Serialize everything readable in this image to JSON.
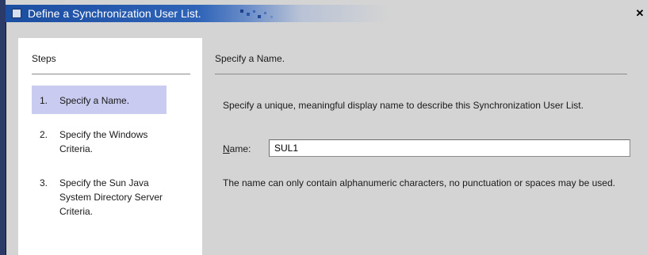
{
  "window": {
    "title": "Define a Synchronization User List.",
    "close_glyph": "✕"
  },
  "steps": {
    "heading": "Steps",
    "items": [
      {
        "number": "1.",
        "label": "Specify a Name.",
        "active": true
      },
      {
        "number": "2.",
        "label": "Specify the Windows Criteria.",
        "active": false
      },
      {
        "number": "3.",
        "label": "Specify the Sun Java System Directory Server Criteria.",
        "active": false
      }
    ]
  },
  "main": {
    "heading": "Specify a Name.",
    "description": "Specify a unique, meaningful display name to describe this Synchronization User List.",
    "name_label_mnemonic": "N",
    "name_label_rest": "ame:",
    "name_value": "SUL1",
    "hint": "The name can only contain alphanumeric characters, no punctuation or spaces may be used."
  },
  "colors": {
    "title_bar": "#1b4da0",
    "active_step": "#c9cbf0",
    "panel_background": "#d4d4d4"
  },
  "icons": {
    "title": "window-icon",
    "close": "close-icon"
  }
}
